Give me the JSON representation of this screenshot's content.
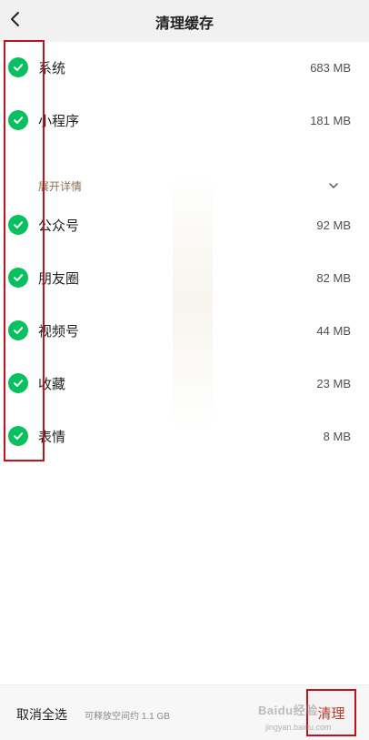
{
  "header": {
    "title": "清理缓存",
    "back_icon": "chevron-left-icon"
  },
  "items": [
    {
      "label": "系统",
      "size": "683 MB",
      "checked": true
    },
    {
      "label": "小程序",
      "size": "181 MB",
      "checked": true
    },
    {
      "label": "公众号",
      "size": "92 MB",
      "checked": true
    },
    {
      "label": "朋友圈",
      "size": "82 MB",
      "checked": true
    },
    {
      "label": "视频号",
      "size": "44 MB",
      "checked": true
    },
    {
      "label": "收藏",
      "size": "23 MB",
      "checked": true
    },
    {
      "label": "表情",
      "size": "8 MB",
      "checked": true
    }
  ],
  "expand": {
    "label": "展开详情",
    "icon": "chevron-down-icon"
  },
  "footer": {
    "deselect_label": "取消全选",
    "free_space": "可释放空间约 1.1 GB",
    "clean_label": "清理"
  },
  "watermark": {
    "text": "Baidu经验",
    "url": "jingyan.baidu.com"
  },
  "colors": {
    "accent_green": "#07c160",
    "highlight_red": "#c1121f",
    "expand_text": "#8a6f55"
  }
}
